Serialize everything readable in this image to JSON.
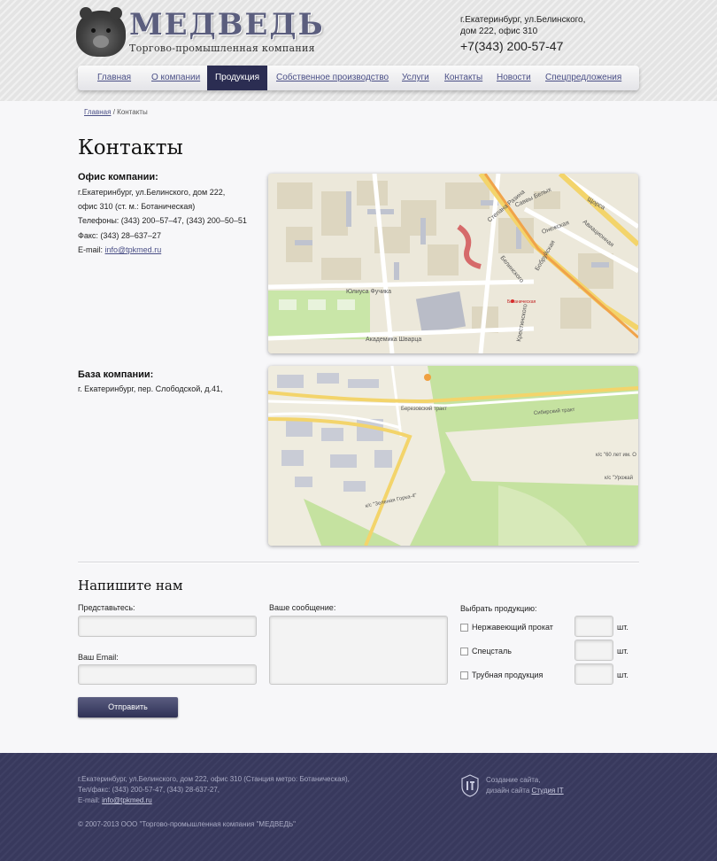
{
  "header": {
    "brand": "МЕДВЕДЬ",
    "tagline": "Торгово-промышленная компания",
    "address_line1": "г.Екатеринбург, ул.Белинского,",
    "address_line2": "дом 222, офис 310",
    "phone": "+7(343) 200-57-47"
  },
  "nav": {
    "items": [
      {
        "label": "Главная"
      },
      {
        "label": "О компании"
      },
      {
        "label": "Продукция"
      },
      {
        "label": "Собственное производство"
      },
      {
        "label": "Услуги"
      },
      {
        "label": "Контакты"
      },
      {
        "label": "Новости"
      },
      {
        "label": "Спецпредложения"
      }
    ],
    "active": "Продукция"
  },
  "breadcrumb": {
    "home": "Главная",
    "separator": "/",
    "current": "Контакты"
  },
  "page_title": "Контакты",
  "office": {
    "title": "Офис компании:",
    "address1": "г.Екатеринбург, ул.Белинского, дом 222,",
    "address2": "офис 310 (ст. м.: Ботаническая)",
    "phones": "Телефоны: (343) 200–57–47, (343) 200–50–51",
    "fax": "Факс: (343) 28–637–27",
    "email_label": "E-mail:",
    "email": "info@tpkmed.ru"
  },
  "map1": {
    "streets": [
      "Юлиуса Фучика",
      "Академика Шварца",
      "Белинского",
      "Бобруйская",
      "Онежская",
      "Щорса",
      "Ботаническая",
      "Степана Разина",
      "Авиационная",
      "Саввы Белых",
      "Крестинского"
    ]
  },
  "base": {
    "title": "База компании:",
    "address": "г. Екатеринбург, пер. Слободской, д.41,"
  },
  "map2": {
    "streets": [
      "Сибирский тракт",
      "Березовский тракт",
      "к/с \"Зеленая Горка-4\"",
      "к/с \"60 лет им. О",
      "к/с \"Урожай"
    ]
  },
  "form": {
    "title": "Напишите нам",
    "name_label": "Представьтесь:",
    "email_label": "Ваш Email:",
    "message_label": "Ваше сообщение:",
    "products_label": "Выбрать продукцию:",
    "products": [
      {
        "label": "Нержавеющий прокат",
        "unit": "шт."
      },
      {
        "label": "Спецсталь",
        "unit": "шт."
      },
      {
        "label": "Трубная продукция",
        "unit": "шт."
      }
    ],
    "submit": "Отправить"
  },
  "footer": {
    "line1": "г.Екатеринбург, ул.Белинского, дом 222, офис 310 (Станция метро: Ботаническая),",
    "line2": "Тел/факс: (343) 200-57-47, (343) 28-637-27,",
    "email_label": "E-mail:",
    "email": "info@tpkmed.ru",
    "copyright": "© 2007-2013 ООО \"Торгово-промышленная компания \"МЕДВЕДЬ\"",
    "studio_line1": "Создание сайта,",
    "studio_line2_prefix": "дизайн сайта",
    "studio_link": "Студия IT"
  },
  "colors": {
    "accent": "#2b2d52",
    "link": "#4a4f86",
    "footer_bg": "#3a3b60"
  }
}
